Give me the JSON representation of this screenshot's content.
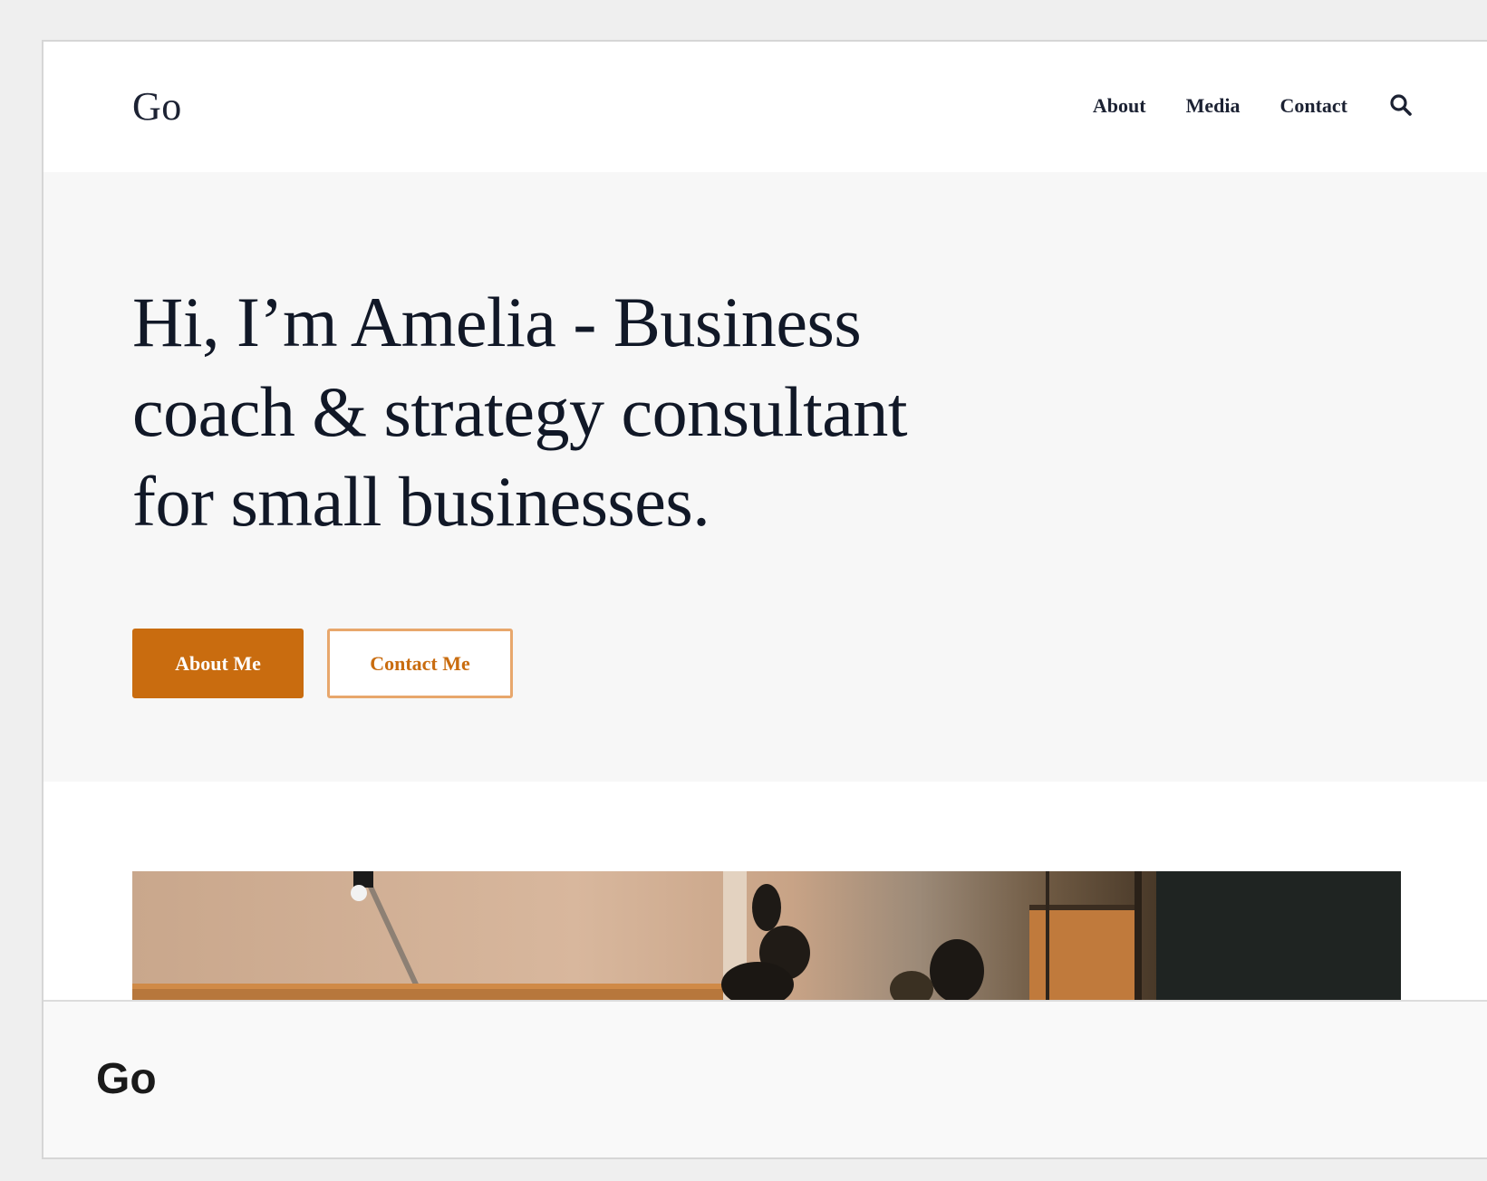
{
  "header": {
    "logo": "Go",
    "nav": [
      {
        "label": "About"
      },
      {
        "label": "Media"
      },
      {
        "label": "Contact"
      }
    ],
    "search_icon": "search-icon"
  },
  "hero": {
    "title": "Hi, I’m Amelia - Business coach & strategy consultant for small businesses.",
    "primary_button": "About Me",
    "secondary_button": "Contact Me"
  },
  "colors": {
    "accent": "#c96c0f",
    "accent_border": "#e8a76c",
    "heading": "#111827",
    "hero_bg": "#f7f7f7"
  },
  "footer": {
    "logo": "Go"
  }
}
